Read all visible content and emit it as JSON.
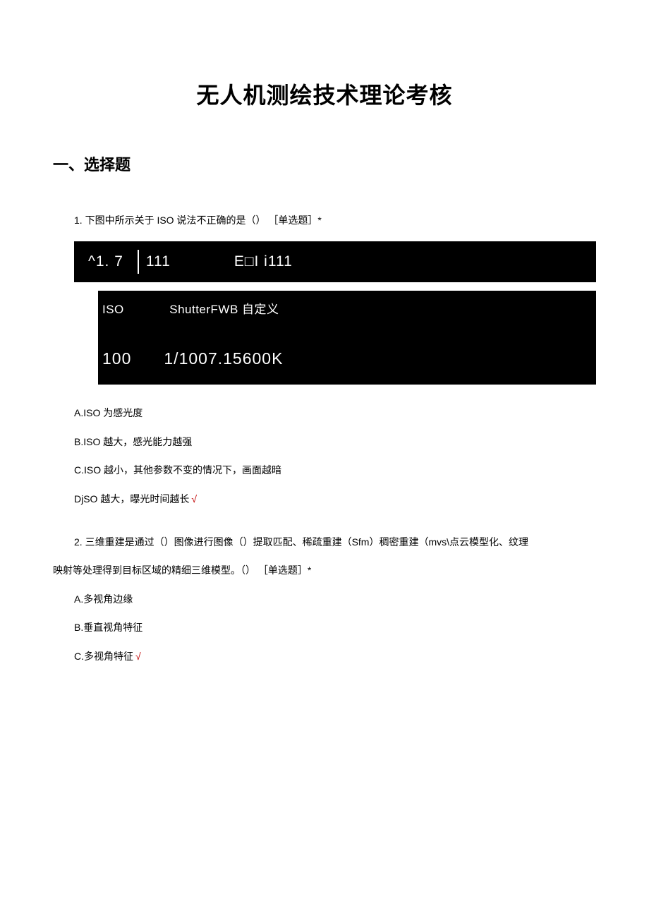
{
  "title": "无人机测绘技术理论考核",
  "section": "一、选择题",
  "q1": {
    "text": "1. 下图中所示关于 ISO 说法不正确的是（） ［单选题］*",
    "figure": {
      "row1_seg1": "^1. 7",
      "row1_seg2": "111",
      "row1_seg3": "E□I i111",
      "row2_iso": "ISO",
      "row2_rest": "ShutterFWB 自定义",
      "row3_val1": "100",
      "row3_val2": "1/1007.15600K"
    },
    "options": {
      "a": "A.ISO 为感光度",
      "b": "B.ISO 越大，感光能力越强",
      "c": "C.ISO 越小，其他参数不变的情况下，画面越暗",
      "d": "DjSO 越大，曝光时间越长",
      "d_mark": "√"
    }
  },
  "q2": {
    "line1": "2. 三维重建是通过（）图像进行图像（）提取匹配、稀疏重建（Sfm）稠密重建（mvs\\点云模型化、纹理",
    "line2": "映射等处理得到目标区域的精细三维模型。（） ［单选题］*",
    "options": {
      "a": "A.多视角边缘",
      "b": "B.垂直视角特征",
      "c": "C.多视角特征",
      "c_mark": "√"
    }
  }
}
